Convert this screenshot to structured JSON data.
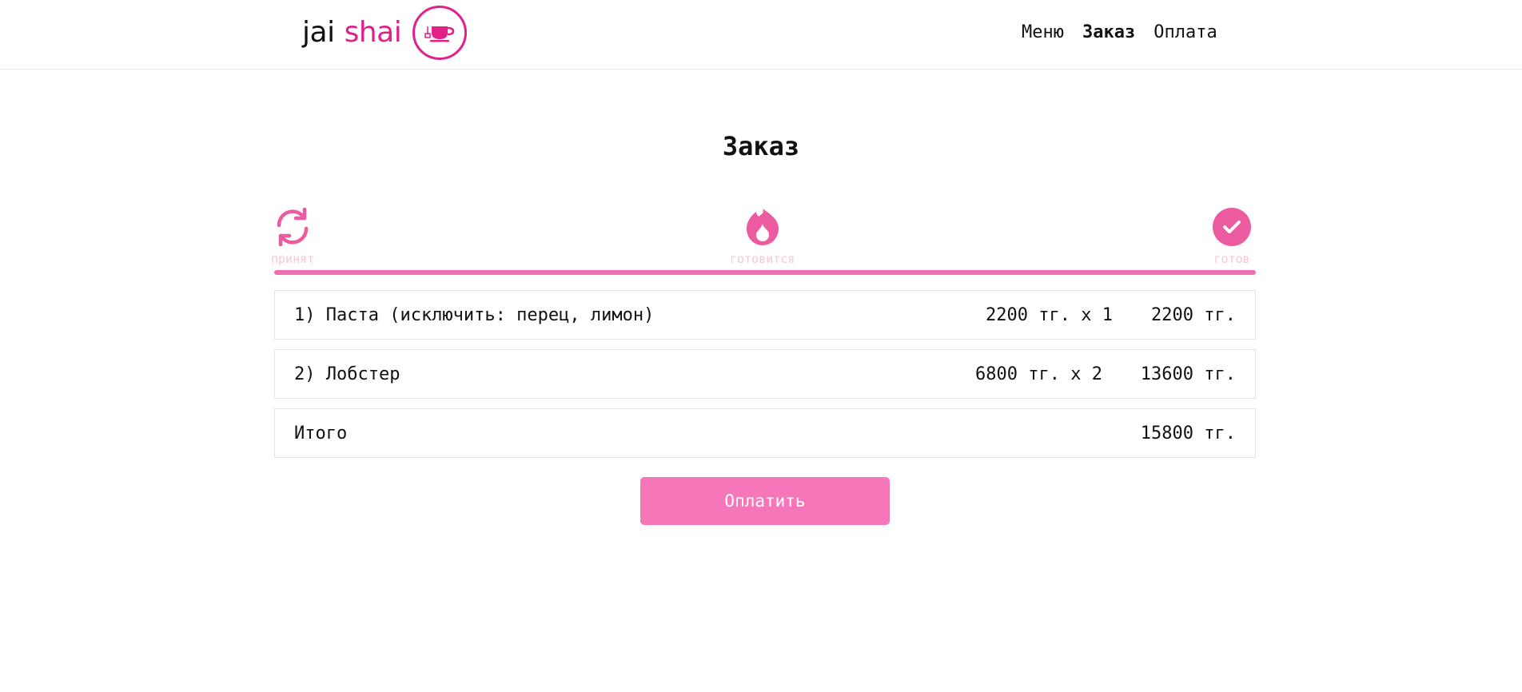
{
  "brand": {
    "word1": "jai",
    "word2": "shai",
    "accent": "#e0218a"
  },
  "nav": {
    "items": [
      "Меню",
      "Заказ",
      "Оплата"
    ],
    "active": "Заказ"
  },
  "page": {
    "title": "Заказ"
  },
  "status": {
    "steps": [
      {
        "label": "принят",
        "icon": "refresh-icon"
      },
      {
        "label": "готовится",
        "icon": "fire-icon"
      },
      {
        "label": "готов",
        "icon": "check-circle-icon"
      }
    ],
    "color": "#ec6fb3"
  },
  "order": {
    "items": [
      {
        "name": "1) Паста (исключить: перец, лимон)",
        "price": "2200 тг. x 1",
        "sum": "2200 тг."
      },
      {
        "name": "2) Лобстер",
        "price": "6800 тг. x 2",
        "sum": "13600 тг."
      }
    ],
    "total_label": "Итого",
    "total_value": "15800 тг."
  },
  "actions": {
    "pay_label": "Оплатить",
    "pay_color": "#f577b9"
  }
}
